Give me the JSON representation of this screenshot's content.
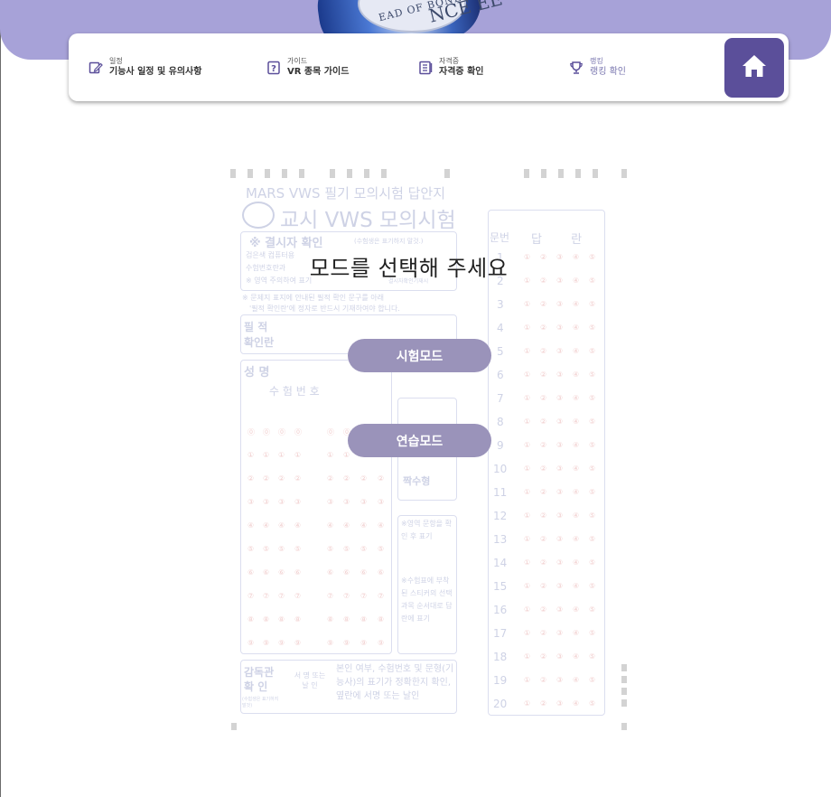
{
  "nav": {
    "items": [
      {
        "small": "일정",
        "main": "기능사 일정 및 유의사항",
        "icon": "edit-icon"
      },
      {
        "small": "가이드",
        "main": "VR 종목 가이드",
        "icon": "help-icon"
      },
      {
        "small": "자격증",
        "main": "자격증 확인",
        "icon": "certificate-icon"
      },
      {
        "small": "랭킹",
        "main": "랭킹 확인",
        "icon": "trophy-icon"
      }
    ],
    "home_icon": "home-icon"
  },
  "hero": {
    "bottle_text_1": "EAD OF BONE",
    "bottle_text_2": "NCE EE"
  },
  "sheet": {
    "title_small": "MARS VWS 필기 모의시험 답안지",
    "title_large": "교시 VWS 모의시험",
    "confirm_header": "※ 결시자 확인",
    "confirm_note": "(수험생은 표기하지 말것.)",
    "confirm_line1": "검은색 컴퓨터용",
    "confirm_line2": "수험번호란과",
    "confirm_line3": "※ 영역 주의하여 표기",
    "confirm_side": "결시자확인기재시",
    "instruction_1": "※ 문제지 표지에 안내된 필적 확인 문구를 아래",
    "instruction_2": "'필적 확인란'에 정자로 반드시 기재하여야 합니다.",
    "handwriting_label": "필 적 확인란",
    "name_label": "성 명",
    "exam_number_label": "수 험 번 호",
    "odd_even_label": "짝수형",
    "note_area_1": "※영역 문항을 확인 후 표기",
    "note_area_2": "※수험표에 부착된 스티커의 선택과목 순서대로 답란에 표기",
    "supervisor_label": "감독관 확 인",
    "supervisor_sub": "(수험생은 표기하지 말것)",
    "signature_label": "서 명 또는 날 인",
    "supervisor_note": "본인 여부, 수험번호 및 문형(기능사)의 표기가 정확한지 확인, 옆란에 서명 또는 날인",
    "answer_header_num": "문번",
    "answer_header_ans": "답 란",
    "bubbles": [
      "①",
      "②",
      "③",
      "④",
      "⑤"
    ],
    "digit_bubbles": [
      "⓪",
      "①",
      "②",
      "③",
      "④",
      "⑤",
      "⑥",
      "⑦",
      "⑧",
      "⑨"
    ],
    "question_numbers": [
      "1",
      "2",
      "3",
      "4",
      "5",
      "6",
      "7",
      "8",
      "9",
      "10",
      "11",
      "12",
      "13",
      "14",
      "15",
      "16",
      "17",
      "18",
      "19",
      "20"
    ]
  },
  "modal": {
    "title": "모드를 선택해 주세요",
    "exam_mode": "시험모드",
    "practice_mode": "연습모드"
  }
}
